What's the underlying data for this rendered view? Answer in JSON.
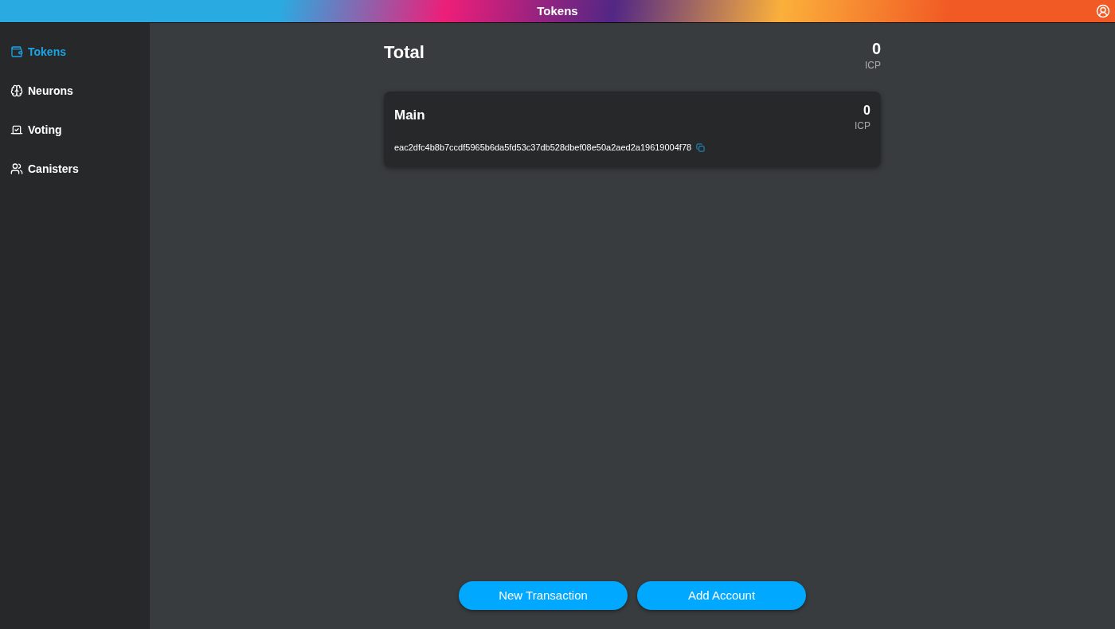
{
  "header": {
    "title": "Tokens"
  },
  "sidebar": {
    "items": [
      {
        "label": "Tokens",
        "kind": "wallet",
        "selected": true
      },
      {
        "label": "Neurons",
        "kind": "brain",
        "selected": false
      },
      {
        "label": "Voting",
        "kind": "ballot",
        "selected": false
      },
      {
        "label": "Canisters",
        "kind": "users",
        "selected": false
      }
    ]
  },
  "total": {
    "title": "Total",
    "amount": "0",
    "unit": "ICP"
  },
  "accounts": [
    {
      "name": "Main",
      "amount": "0",
      "unit": "ICP",
      "address": "eac2dfc4b8b7ccdf5965b6da5fd53c37db528dbef08e50a2aed2a19619004f78"
    }
  ],
  "buttons": [
    "New Transaction",
    "Add Account"
  ]
}
